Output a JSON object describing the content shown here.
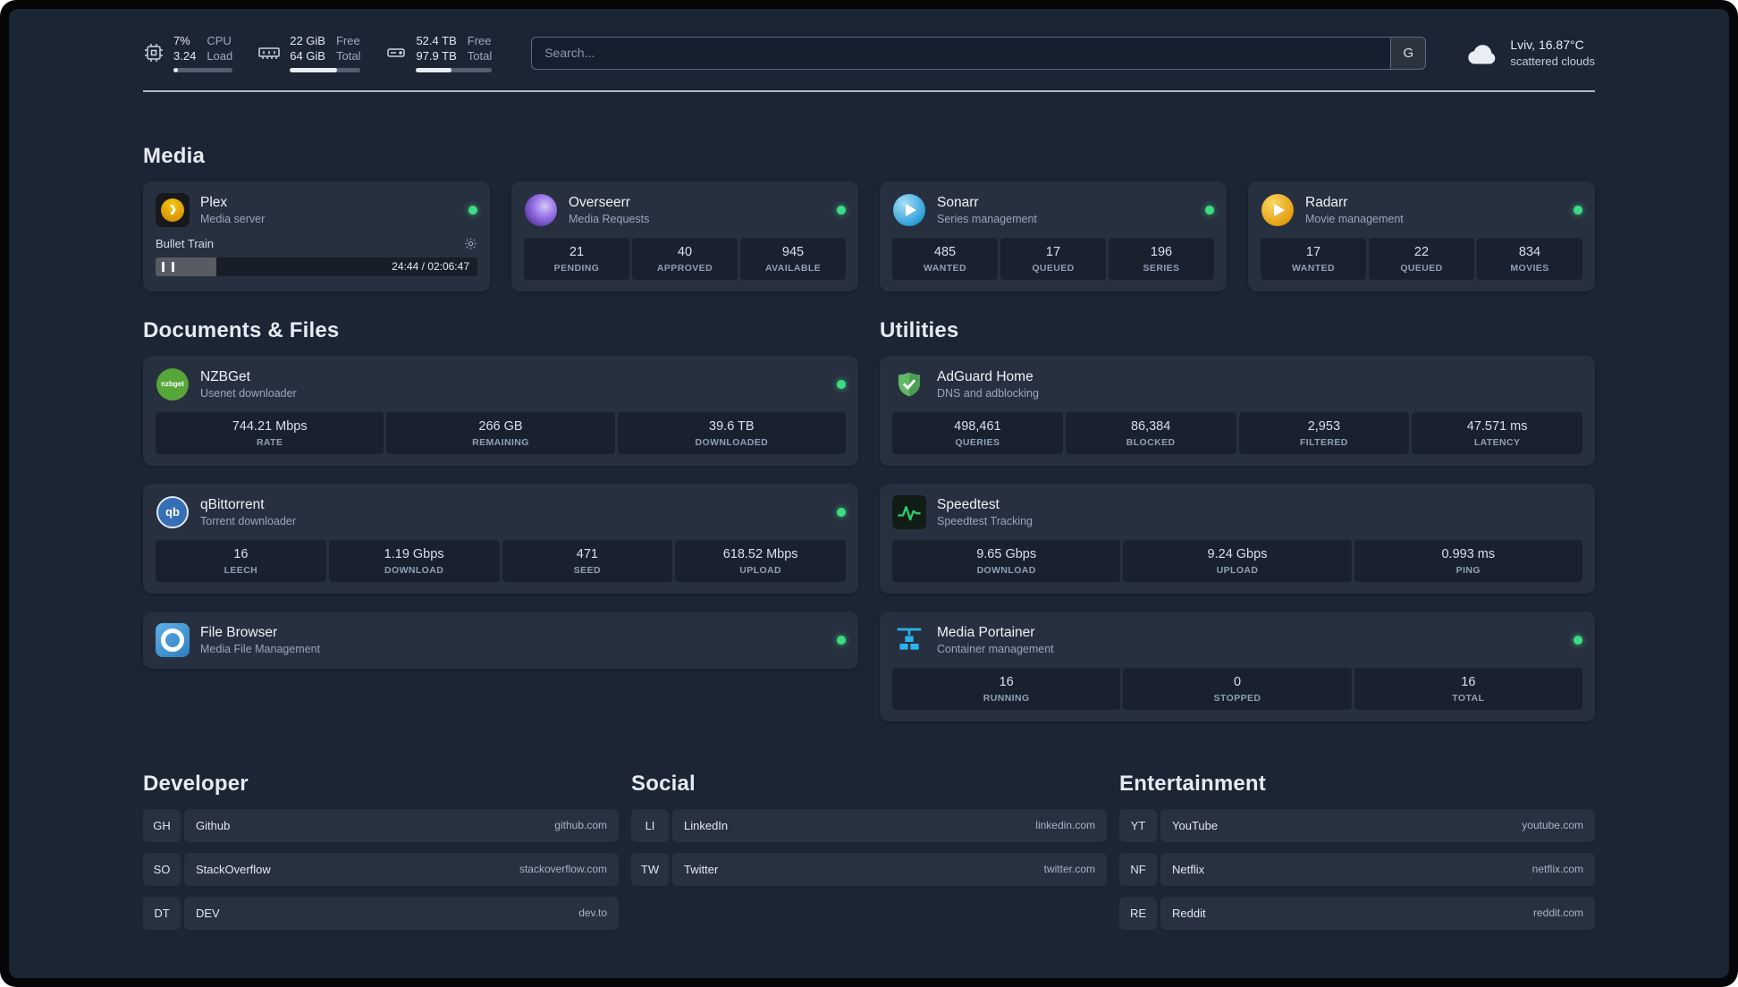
{
  "colors": {
    "status_online": "#3ddc84",
    "background": "#1b2534"
  },
  "topbar": {
    "cpu": {
      "value_top": "7%",
      "value_bottom": "3.24",
      "label_top": "CPU",
      "label_bottom": "Load",
      "bar_percent": 7
    },
    "memory": {
      "value_top": "22 GiB",
      "value_bottom": "64 GiB",
      "label_top": "Free",
      "label_bottom": "Total",
      "bar_percent": 66
    },
    "disk": {
      "value_top": "52.4 TB",
      "value_bottom": "97.9 TB",
      "label_top": "Free",
      "label_bottom": "Total",
      "bar_percent": 47
    },
    "search": {
      "placeholder": "Search...",
      "provider_label": "G"
    },
    "weather": {
      "location": "Lviv, 16.87°C",
      "condition": "scattered clouds"
    }
  },
  "sections": {
    "media": {
      "title": "Media",
      "plex": {
        "name": "Plex",
        "subtitle": "Media server",
        "now_playing": "Bullet Train",
        "time": "24:44 / 02:06:47",
        "progress_percent": 19
      },
      "overseerr": {
        "name": "Overseerr",
        "subtitle": "Media Requests",
        "stats": [
          {
            "value": "21",
            "label": "PENDING"
          },
          {
            "value": "40",
            "label": "APPROVED"
          },
          {
            "value": "945",
            "label": "AVAILABLE"
          }
        ]
      },
      "sonarr": {
        "name": "Sonarr",
        "subtitle": "Series management",
        "stats": [
          {
            "value": "485",
            "label": "WANTED"
          },
          {
            "value": "17",
            "label": "QUEUED"
          },
          {
            "value": "196",
            "label": "SERIES"
          }
        ]
      },
      "radarr": {
        "name": "Radarr",
        "subtitle": "Movie management",
        "stats": [
          {
            "value": "17",
            "label": "WANTED"
          },
          {
            "value": "22",
            "label": "QUEUED"
          },
          {
            "value": "834",
            "label": "MOVIES"
          }
        ]
      }
    },
    "documents": {
      "title": "Documents & Files",
      "nzbget": {
        "name": "NZBGet",
        "subtitle": "Usenet downloader",
        "icon_text": "nzbget",
        "stats": [
          {
            "value": "744.21 Mbps",
            "label": "RATE"
          },
          {
            "value": "266 GB",
            "label": "REMAINING"
          },
          {
            "value": "39.6 TB",
            "label": "DOWNLOADED"
          }
        ]
      },
      "qbittorrent": {
        "name": "qBittorrent",
        "subtitle": "Torrent downloader",
        "icon_text": "qb",
        "stats": [
          {
            "value": "16",
            "label": "LEECH"
          },
          {
            "value": "1.19 Gbps",
            "label": "DOWNLOAD"
          },
          {
            "value": "471",
            "label": "SEED"
          },
          {
            "value": "618.52 Mbps",
            "label": "UPLOAD"
          }
        ]
      },
      "filebrowser": {
        "name": "File Browser",
        "subtitle": "Media File Management"
      }
    },
    "utilities": {
      "title": "Utilities",
      "adguard": {
        "name": "AdGuard Home",
        "subtitle": "DNS and adblocking",
        "stats": [
          {
            "value": "498,461",
            "label": "QUERIES"
          },
          {
            "value": "86,384",
            "label": "BLOCKED"
          },
          {
            "value": "2,953",
            "label": "FILTERED"
          },
          {
            "value": "47.571 ms",
            "label": "LATENCY"
          }
        ]
      },
      "speedtest": {
        "name": "Speedtest",
        "subtitle": "Speedtest Tracking",
        "stats": [
          {
            "value": "9.65 Gbps",
            "label": "DOWNLOAD"
          },
          {
            "value": "9.24 Gbps",
            "label": "UPLOAD"
          },
          {
            "value": "0.993 ms",
            "label": "PING"
          }
        ]
      },
      "portainer": {
        "name": "Media Portainer",
        "subtitle": "Container management",
        "stats": [
          {
            "value": "16",
            "label": "RUNNING"
          },
          {
            "value": "0",
            "label": "STOPPED"
          },
          {
            "value": "16",
            "label": "TOTAL"
          }
        ]
      }
    },
    "bookmarks": [
      {
        "title": "Developer",
        "items": [
          {
            "abbr": "GH",
            "name": "Github",
            "url": "github.com"
          },
          {
            "abbr": "SO",
            "name": "StackOverflow",
            "url": "stackoverflow.com"
          },
          {
            "abbr": "DT",
            "name": "DEV",
            "url": "dev.to"
          }
        ]
      },
      {
        "title": "Social",
        "items": [
          {
            "abbr": "LI",
            "name": "LinkedIn",
            "url": "linkedin.com"
          },
          {
            "abbr": "TW",
            "name": "Twitter",
            "url": "twitter.com"
          }
        ]
      },
      {
        "title": "Entertainment",
        "items": [
          {
            "abbr": "YT",
            "name": "YouTube",
            "url": "youtube.com"
          },
          {
            "abbr": "NF",
            "name": "Netflix",
            "url": "netflix.com"
          },
          {
            "abbr": "RE",
            "name": "Reddit",
            "url": "reddit.com"
          }
        ]
      }
    ]
  }
}
